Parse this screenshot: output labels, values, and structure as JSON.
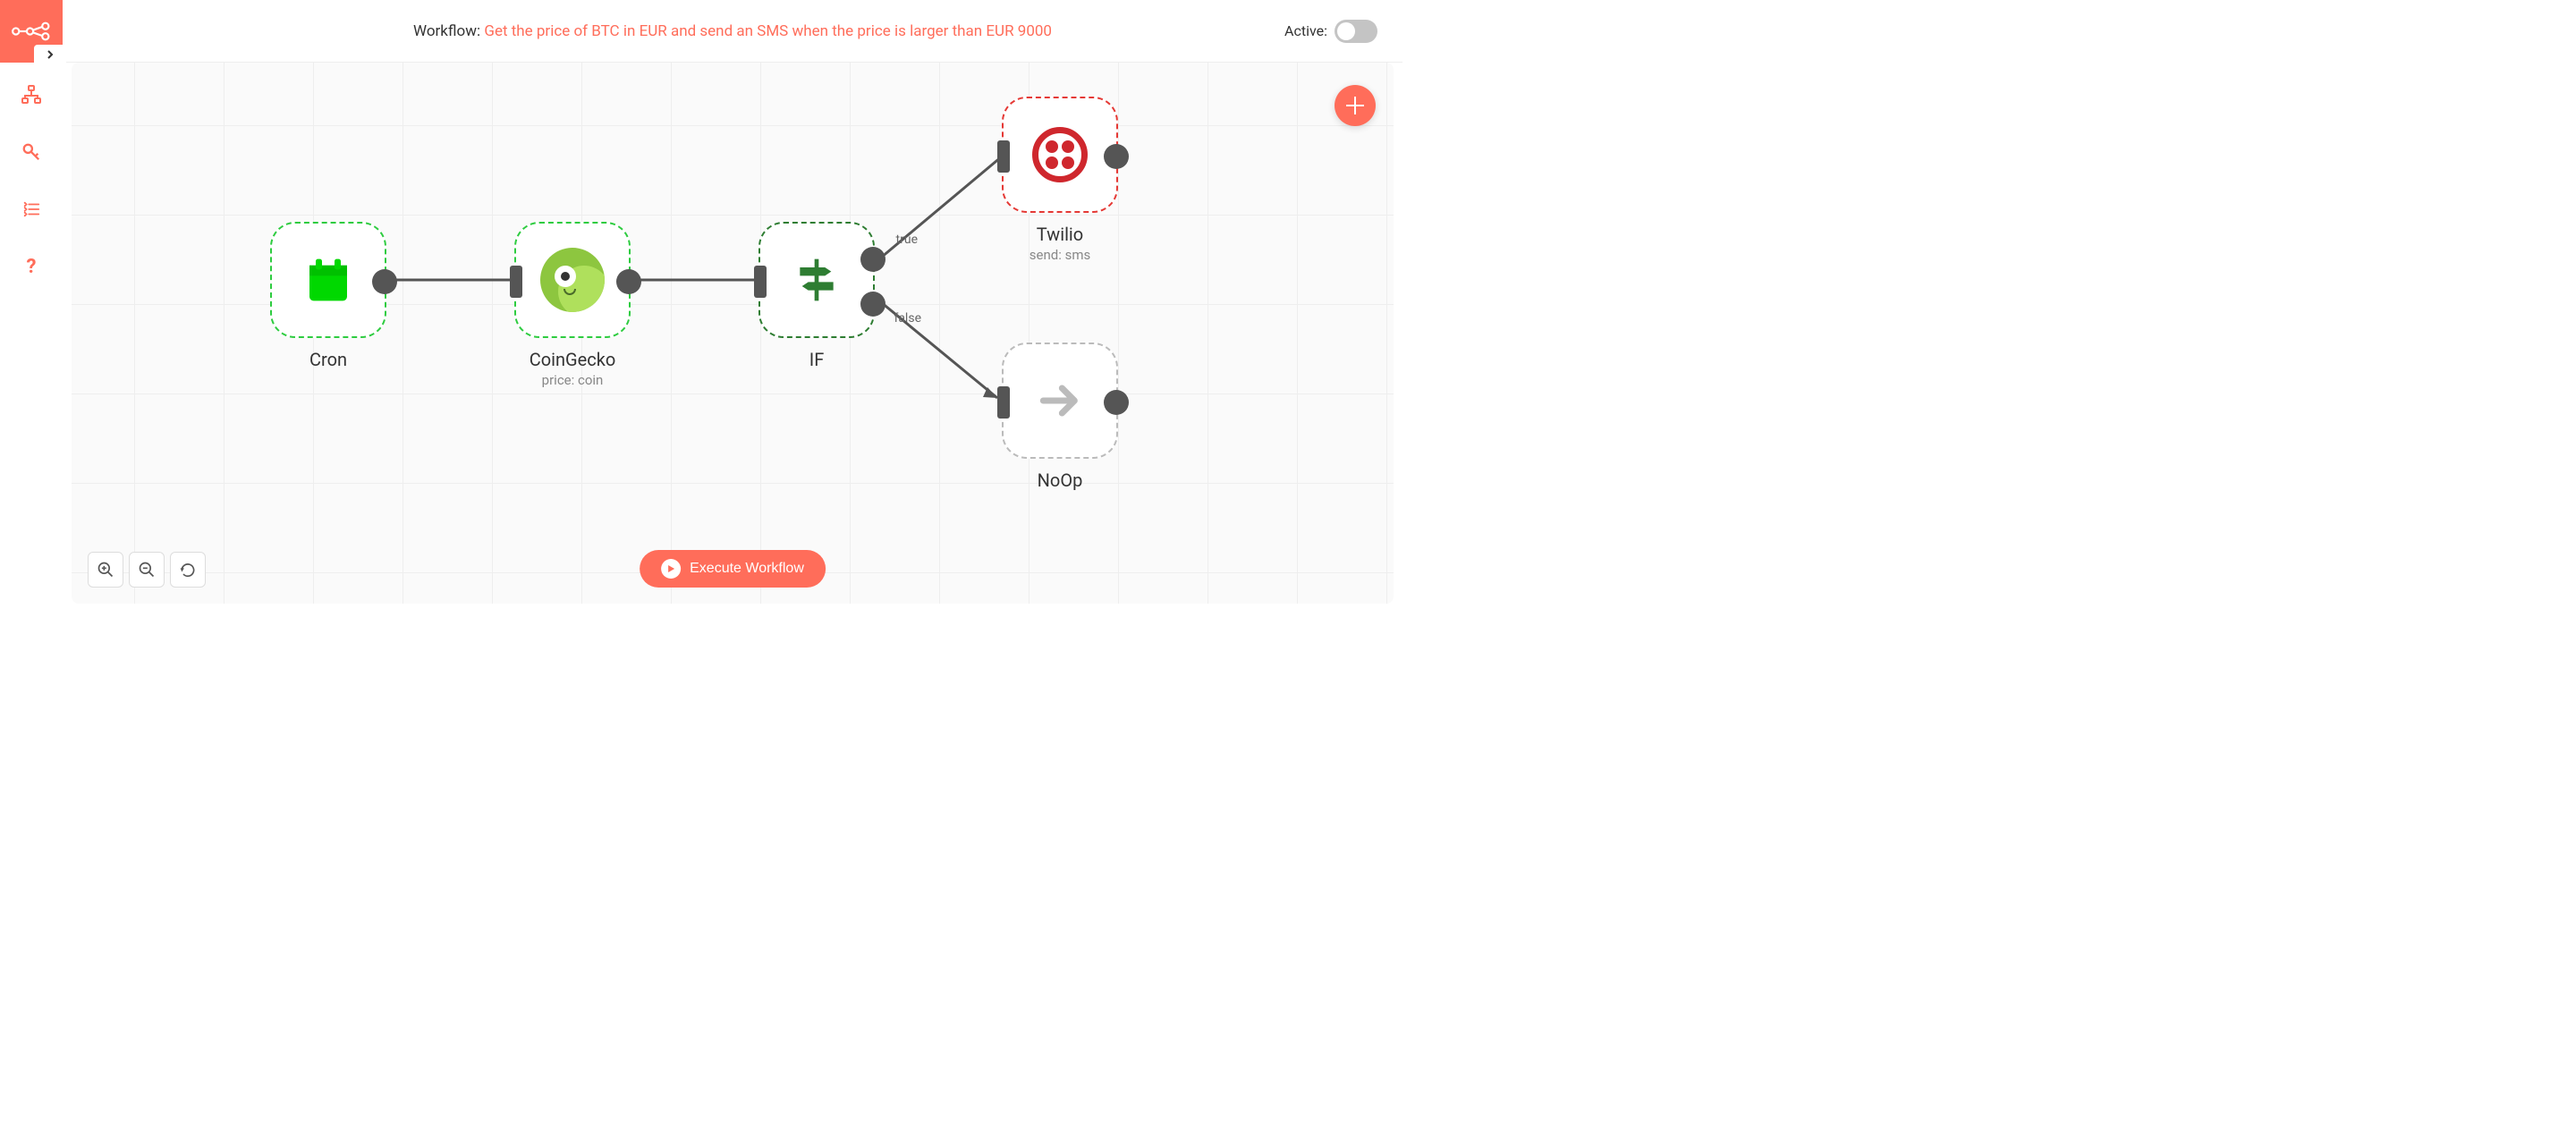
{
  "header": {
    "prefix": "Workflow: ",
    "name": "Get the price of BTC in EUR and send an SMS when the price is larger than EUR 9000",
    "active_label": "Active:"
  },
  "nodes": {
    "cron": {
      "label": "Cron"
    },
    "coingecko": {
      "label": "CoinGecko",
      "sub": "price: coin"
    },
    "if": {
      "label": "IF",
      "true_label": "true",
      "false_label": "false"
    },
    "twilio": {
      "label": "Twilio",
      "sub": "send: sms"
    },
    "noop": {
      "label": "NoOp"
    }
  },
  "execute_label": "Execute Workflow",
  "sidebar_icons": [
    "workflows",
    "credentials",
    "executions",
    "help"
  ]
}
